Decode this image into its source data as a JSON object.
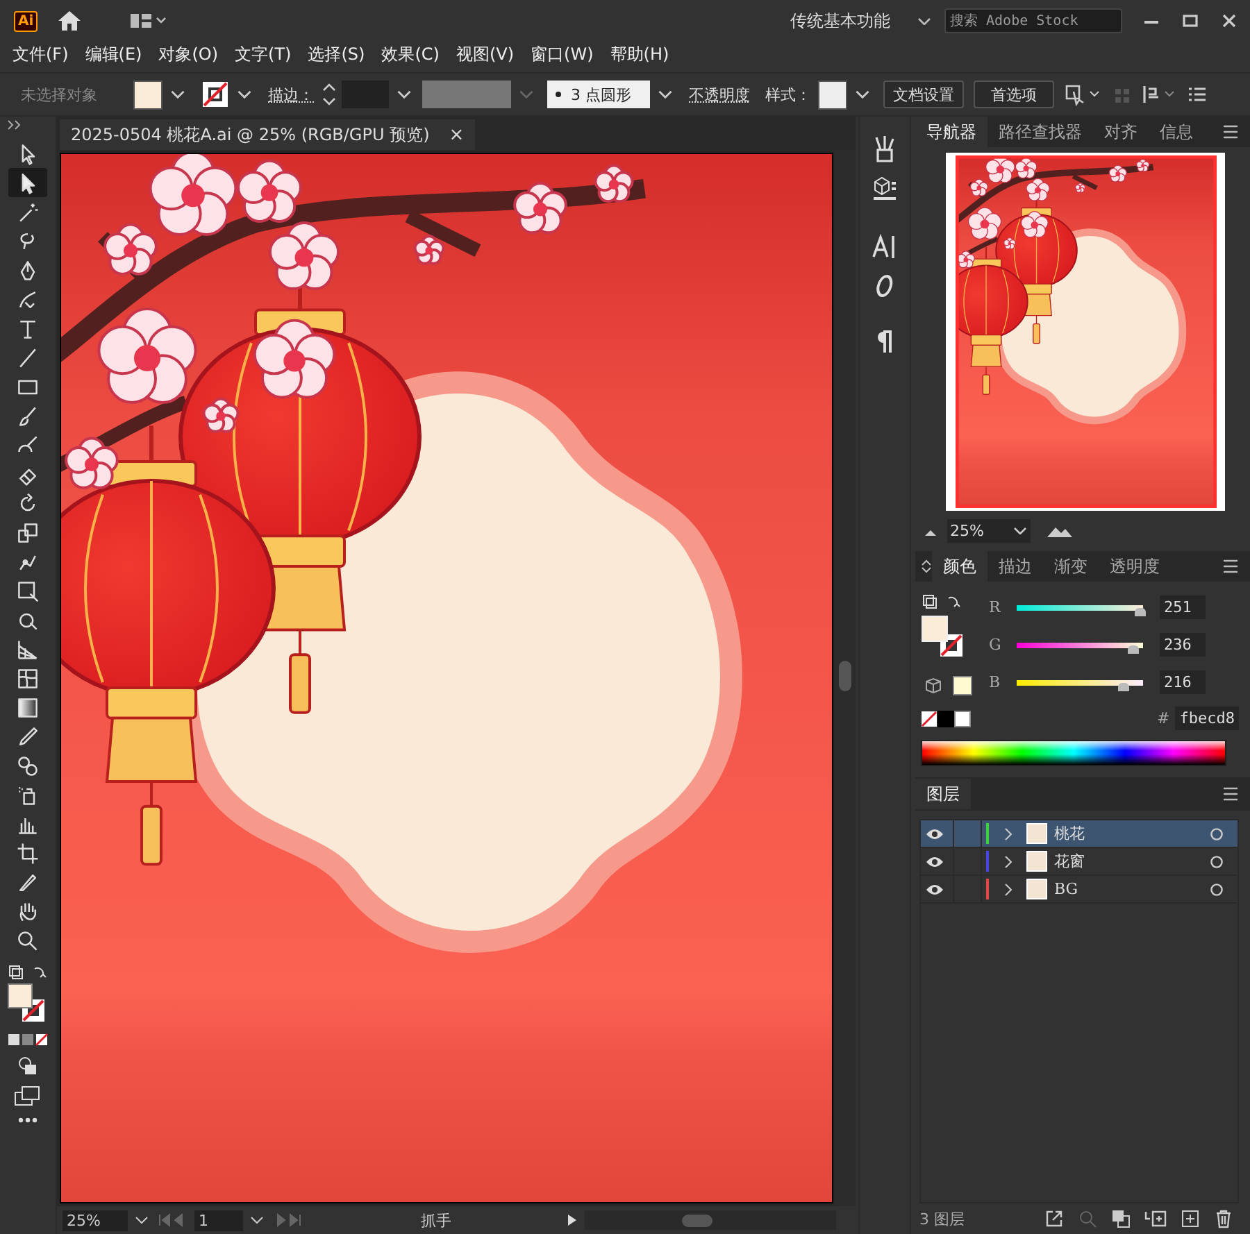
{
  "app": {
    "logo": "Ai",
    "workspace": "传统基本功能"
  },
  "search": {
    "placeholder": "搜索 Adobe Stock"
  },
  "menu": [
    "文件(F)",
    "编辑(E)",
    "对象(O)",
    "文字(T)",
    "选择(S)",
    "效果(C)",
    "视图(V)",
    "窗口(W)",
    "帮助(H)"
  ],
  "control_bar": {
    "selection": "未选择对象",
    "stroke_label": "描边：",
    "brush": "3 点圆形",
    "opacity_label": "不透明度",
    "style_label": "样式：",
    "buttons": [
      "文档设置",
      "首选项"
    ]
  },
  "tools": [
    {
      "selected": false
    },
    {
      "selected": true
    },
    {
      "selected": false
    },
    {
      "selected": false
    },
    {
      "selected": false
    },
    {
      "selected": false
    },
    {
      "selected": false
    },
    {
      "selected": false
    },
    {
      "selected": false
    },
    {
      "selected": false
    },
    {
      "selected": false
    },
    {
      "selected": false
    },
    {
      "selected": false
    },
    {
      "selected": false
    },
    {
      "selected": false
    },
    {
      "selected": false
    },
    {
      "selected": false
    },
    {
      "selected": false
    },
    {
      "selected": false
    },
    {
      "selected": false
    },
    {
      "selected": false
    },
    {
      "selected": false
    },
    {
      "selected": false
    },
    {
      "selected": false
    },
    {
      "selected": false
    },
    {
      "selected": false
    },
    {
      "selected": false
    },
    {
      "selected": false
    }
  ],
  "document_tab": {
    "title": "2025-0504 桃花A.ai @ 25% (RGB/GPU 预览)",
    "close": "×"
  },
  "navigator": {
    "tabs": [
      {
        "label": "导航器",
        "selected": true
      },
      {
        "label": "路径查找器",
        "selected": false
      },
      {
        "label": "对齐",
        "selected": false
      },
      {
        "label": "信息",
        "selected": false
      }
    ],
    "zoom": "25%"
  },
  "color_panel": {
    "tabs": [
      {
        "label": "颜色",
        "selected": true
      },
      {
        "label": "描边",
        "selected": false
      },
      {
        "label": "渐变",
        "selected": false
      },
      {
        "label": "透明度",
        "selected": false
      }
    ],
    "channels": [
      {
        "name": "R",
        "level": 0.98,
        "value": "251"
      },
      {
        "name": "G",
        "level": 0.92,
        "value": "236"
      },
      {
        "name": "B",
        "level": 0.85,
        "value": "216"
      }
    ],
    "hex_label": "#",
    "hex": "fbecd8"
  },
  "layers_panel": {
    "tabs": [
      {
        "label": "图层",
        "selected": true
      }
    ],
    "layers": [
      {
        "name": "桃花",
        "color": "#3cd23c",
        "selected": true
      },
      {
        "name": "花窗",
        "color": "#4646e6",
        "selected": false
      },
      {
        "name": "BG",
        "color": "#e64646",
        "selected": false
      }
    ],
    "count": "3 图层"
  },
  "status_bar": {
    "zoom": "25%",
    "page": "1",
    "tool": "抓手"
  }
}
